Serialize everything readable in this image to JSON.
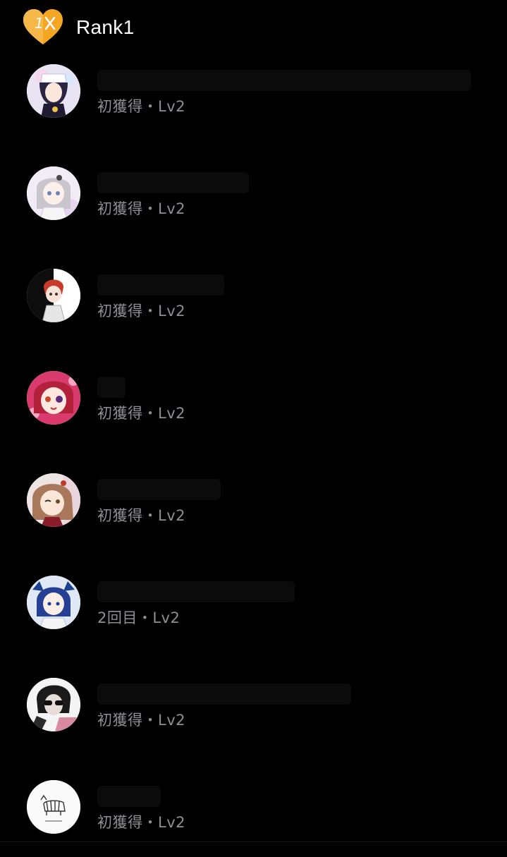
{
  "header": {
    "badge_number": "1",
    "title": "Rank1"
  },
  "colors": {
    "background": "#000000",
    "badge_orange": "#f5a623",
    "meta_gray": "#8e8e93"
  },
  "entries": [
    {
      "meta": "初獲得・Lv2"
    },
    {
      "meta": "初獲得・Lv2"
    },
    {
      "meta": "初獲得・Lv2"
    },
    {
      "meta": "初獲得・Lv2"
    },
    {
      "meta": "初獲得・Lv2"
    },
    {
      "meta": "2回目・Lv2"
    },
    {
      "meta": "初獲得・Lv2"
    },
    {
      "meta": "初獲得・Lv2"
    }
  ]
}
